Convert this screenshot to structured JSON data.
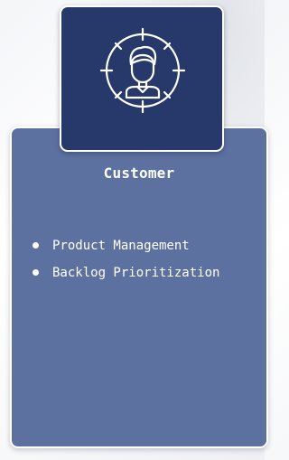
{
  "card": {
    "title": "Customer",
    "icon": "customer-target-icon",
    "items": [
      {
        "label": "Product Management"
      },
      {
        "label": "Backlog Prioritization"
      }
    ]
  },
  "colors": {
    "icon_box": "#27386a",
    "card": "#5d71a0",
    "text": "#ffffff"
  }
}
